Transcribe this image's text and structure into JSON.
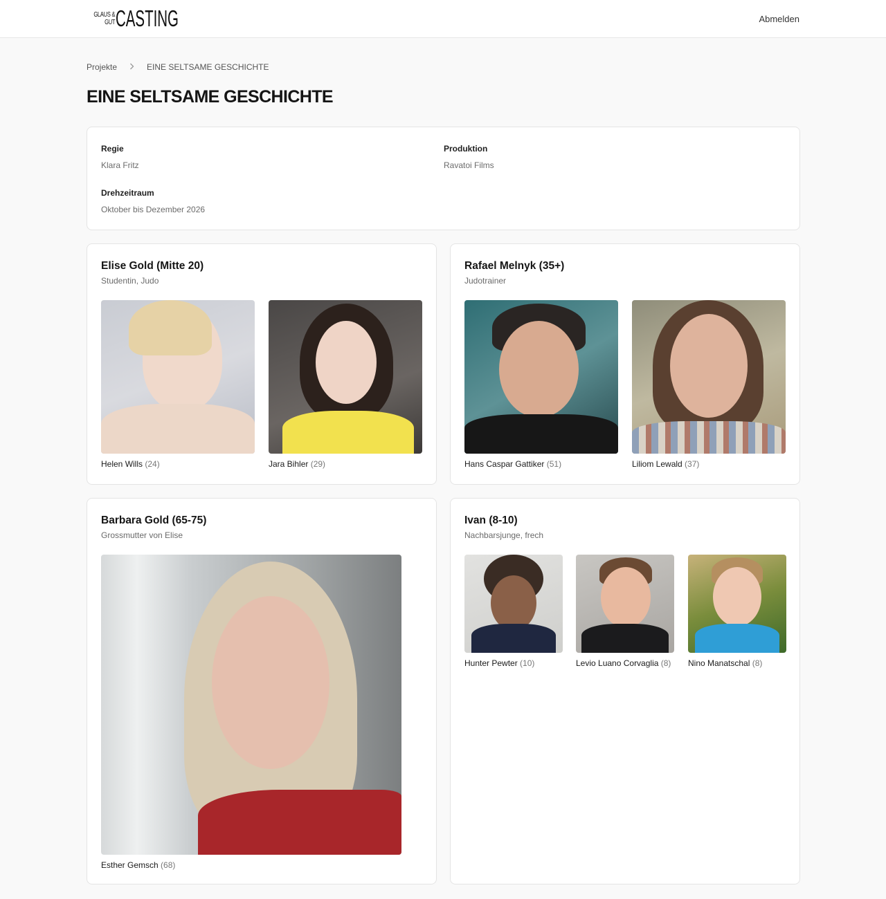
{
  "header": {
    "logo_small_line1": "GLAUS &",
    "logo_small_line2": "GUT",
    "logo_big": "CASTING",
    "logout_label": "Abmelden"
  },
  "breadcrumb": {
    "parent": "Projekte",
    "separator_icon": "chevron-right-icon",
    "current": "EINE SELTSAME GESCHICHTE"
  },
  "page_title": "EINE SELTSAME GESCHICHTE",
  "info": {
    "regie_label": "Regie",
    "regie_value": "Klara Fritz",
    "produktion_label": "Produktion",
    "produktion_value": "Ravatoi Films",
    "drehzeitraum_label": "Drehzeitraum",
    "drehzeitraum_value": "Oktober bis Dezember 2026"
  },
  "roles": [
    {
      "title": "Elise Gold (Mitte 20)",
      "subtitle": "Studentin, Judo",
      "actors": [
        {
          "name": "Helen Wills",
          "age": "(24)"
        },
        {
          "name": "Jara Bihler",
          "age": "(29)"
        }
      ]
    },
    {
      "title": "Rafael Melnyk (35+)",
      "subtitle": "Judotrainer",
      "actors": [
        {
          "name": "Hans Caspar Gattiker",
          "age": "(51)"
        },
        {
          "name": "Liliom Lewald",
          "age": "(37)"
        }
      ]
    },
    {
      "title": "Barbara Gold (65-75)",
      "subtitle": "Grossmutter von Elise",
      "actors": [
        {
          "name": "Esther Gemsch",
          "age": "(68)"
        }
      ]
    },
    {
      "title": "Ivan (8-10)",
      "subtitle": "Nachbarsjunge, frech",
      "actors": [
        {
          "name": "Hunter Pewter",
          "age": "(10)"
        },
        {
          "name": "Levio Luano Corvaglia",
          "age": "(8)"
        },
        {
          "name": "Nino Manatschal",
          "age": "(8)"
        }
      ]
    }
  ],
  "colors": {
    "page_bg": "#f9f9f9",
    "card_bg": "#ffffff",
    "border": "#e4e4e4",
    "muted_text": "#6b6b6b"
  }
}
